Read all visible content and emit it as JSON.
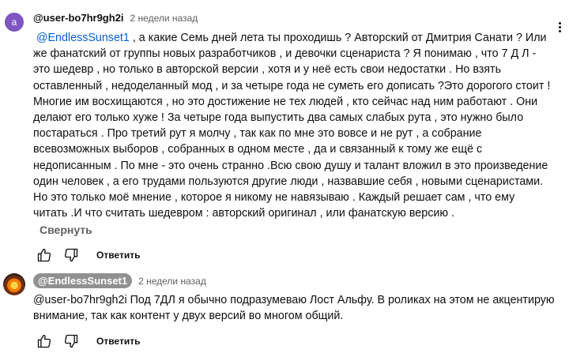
{
  "comments": [
    {
      "avatar_letter": "a",
      "author": "@user-bo7hr9gh2i",
      "time": "2 недели назад",
      "mention": "@EndlessSunset1",
      "lines": [
        ", а какие Семь дней лета ты проходишь ? Авторский от Дмитрия Санати ? Или",
        "же фанатский от группы новых разработчиков , и девочки сценариста ?  Я понимаю , что 7 Д Л -",
        "это шедевр , но только в авторской версии , хотя и у неё есть свои недостатки . Но взять",
        "оставленный , недоделанный мод , и за четыре года не суметь его дописать ?Это дорогого стоит !",
        "Многие им восхищаются ,  но это достижение не тех людей , кто сейчас над ним работают . Они",
        "делают его только хуже ! За четыре года выпустить два самых слабых рута , это нужно было",
        "постараться . Про  третий рут я молчу , так как по мне это вовсе и не рут , а собрание",
        "всевозможных выборов , собранных в одном месте , да и связанный к тому же ещё с",
        "недописанным . По мне - это очень странно .Всю свою душу и талант вложил в это произведение",
        "один человек , а его трудами пользуются другие люди , назвавшие себя , новыми сценаристами.",
        "Но это только моё мнение , которое я никому не навязываю . Каждый решает сам ,  что ему",
        "читать .И что считать шедевром : авторский оригинал , или фанатскую версию ."
      ],
      "collapse_label": "Свернуть",
      "reply_label": "Ответить"
    },
    {
      "author": "@EndlessSunset1",
      "time": "2 недели назад",
      "lines": [
        "@user-bo7hr9gh2i Под 7ДЛ я обычно подразумеваю Лост Альфу. В роликах на этом не акцентирую",
        "внимание, так как контент у двух версий во многом общий."
      ],
      "reply_label": "Ответить"
    }
  ],
  "icons": [
    "like-icon",
    "dislike-icon",
    "more-actions-icon"
  ],
  "colors": {
    "mention": "#065fd4",
    "avatar_a": "#7e57c2",
    "secondary_text": "#606060",
    "author_chip": "#909090"
  }
}
